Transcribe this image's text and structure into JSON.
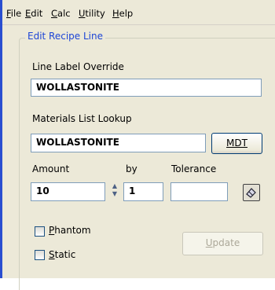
{
  "menu": {
    "items": [
      {
        "mnemonic": "F",
        "rest": "ile"
      },
      {
        "mnemonic": "E",
        "rest": "dit"
      },
      {
        "mnemonic": "C",
        "rest": "alc"
      },
      {
        "mnemonic": "U",
        "rest": "tility"
      },
      {
        "mnemonic": "H",
        "rest": "elp"
      }
    ]
  },
  "group": {
    "title": "Edit Recipe Line"
  },
  "line_label": {
    "label": "Line Label Override",
    "value": "WOLLASTONITE"
  },
  "materials": {
    "label": "Materials List Lookup",
    "value": "WOLLASTONITE",
    "button": "MDT"
  },
  "amount": {
    "label": "Amount",
    "value": "10"
  },
  "by": {
    "label": "by",
    "value": "1"
  },
  "tolerance": {
    "label": "Tolerance",
    "value": ""
  },
  "phantom": {
    "mnemonic": "P",
    "rest": "hantom",
    "checked": false
  },
  "static": {
    "mnemonic": "S",
    "rest": "tatic",
    "checked": false
  },
  "update": {
    "mnemonic": "U",
    "rest": "pdate",
    "enabled": false
  },
  "icons": {
    "picker": "eraser-icon"
  },
  "colors": {
    "accent": "#1d45d6",
    "window_bg": "#ece9d8",
    "border": "#7f9db9"
  }
}
